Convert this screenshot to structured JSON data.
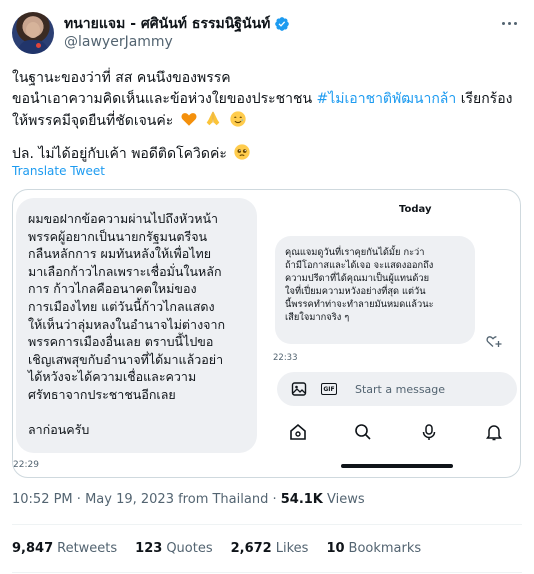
{
  "author": {
    "display_name": "ทนายแจม - ศศินันท์ ธรรมนิฐินันท์",
    "handle": "@lawyerJammy"
  },
  "tweet": {
    "line1": "ในฐานะของว่าที่ สส คนนึงของพรรค",
    "line2_pre": "ขอนำเอาความคิดเห็นและข้อห่วงใยของประชาชน ",
    "line2_hashtag": "#ไม่เอาชาติพัฒนากล้า",
    "line2_post": " เรียกร้อง",
    "line3": "ให้พรรคมีจุดยืนที่ชัดเจนค่ะ",
    "para2": "ปล. ไม่ได้อยู่กับเค้า พอดีติดโควิดค่ะ",
    "emojis": [
      "orange-heart",
      "folded-hands",
      "smiling-face-with-tear",
      "pleading-face"
    ],
    "translate_label": "Translate Tweet"
  },
  "media": {
    "left_message_lines": [
      "ผมขอฝากข้อความผ่านไปถึงหัวหน้า",
      "พรรคผู้อยากเป็นนายกรัฐมนตรีจน",
      "กลืนหลักการ ผมทันหลังให้เพื่อไทย",
      "มาเลือกก้าวไกลเพราะเชื่อมั่นในหลัก",
      "การ ก้าวไกลคืออนาคตใหม่ของ",
      "การเมืองไทย แต่วันนี้ก้าวไกลแสดง",
      "ให้เห็นว่าลุ่มหลงในอำนาจไม่ต่างจาก",
      "พรรคการเมืองอื่นเลย ตราบนี้ไปขอ",
      "เชิญเสพสุขกับอำนาจที่ได้มาแล้วอย่า",
      "ได้หวังจะได้ความเชื่อและความ",
      "ศรัทธาจากประชาชนอีกเลย"
    ],
    "left_message_bye": "ลาก่อนครับ",
    "left_time": "22:29",
    "today_label": "Today",
    "right_message_lines": [
      "คุณแจมดูวันที่เราคุยกันได้มั้ย กะว่า",
      "ถ้ามีโอกาสและได้เจอ จะแสดงออกถึง",
      "ความปรีดาที่ได้คุณมาเป็นผู้แทนด้วย",
      "ใจที่เปี่ยมความหวังอย่างที่สุด แต่วัน",
      "นี้พรรคทำท่าจะทำลายมันหมดแล้วนะ",
      "เสียใจมากจริง ๆ"
    ],
    "right_time": "22:33",
    "composer_placeholder": "Start a message",
    "gif_label": "GIF"
  },
  "meta": {
    "time": "10:52 PM",
    "date": "May 19, 2023",
    "source": "from Thailand",
    "views_count": "54.1K",
    "views_label": "Views"
  },
  "stats": {
    "retweets_count": "9,847",
    "retweets_label": "Retweets",
    "quotes_count": "123",
    "quotes_label": "Quotes",
    "likes_count": "2,672",
    "likes_label": "Likes",
    "bookmarks_count": "10",
    "bookmarks_label": "Bookmarks"
  },
  "colors": {
    "accent": "#1d9bf0",
    "text": "#0f1419",
    "muted": "#536471",
    "bubble": "#eef0f3"
  }
}
